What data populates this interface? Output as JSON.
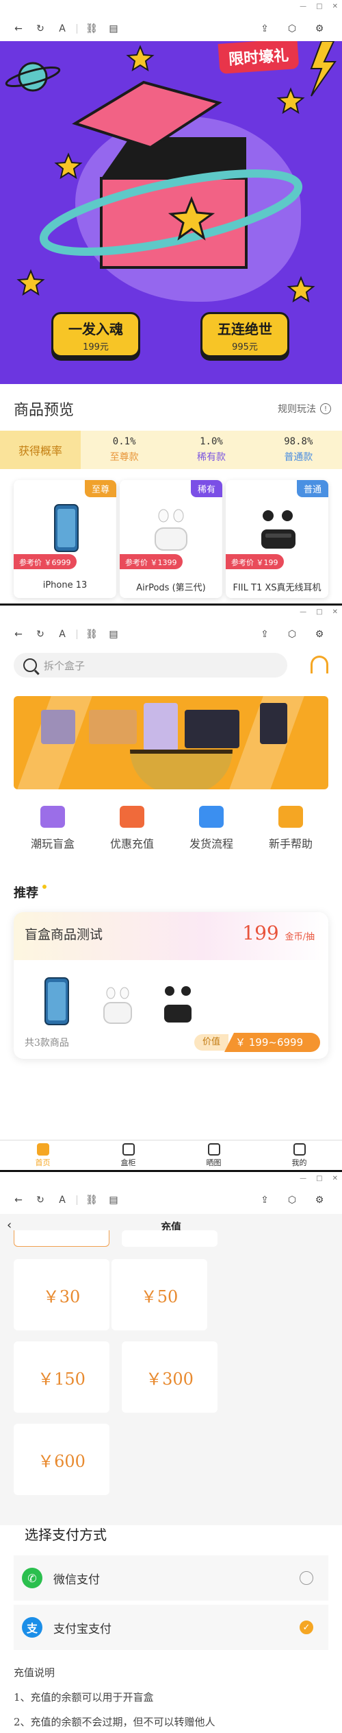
{
  "window": {
    "minimize": "—",
    "maximize": "□",
    "close": "✕"
  },
  "toolbar_icons": [
    "back-arrow-icon",
    "refresh-icon",
    "font-icon",
    "link-icon",
    "calendar-icon",
    "share-icon",
    "cube-icon",
    "settings-icon"
  ],
  "hero": {
    "promo": "限时壕礼",
    "single": {
      "label": "一发入魂",
      "price": "199元"
    },
    "five": {
      "label": "五连绝世",
      "price": "995元"
    }
  },
  "preview": {
    "title": "商品预览",
    "rules": "规则玩法",
    "prob_label": "获得概率",
    "tiers": [
      {
        "pct": "0.1%",
        "name": "至尊款",
        "color": "#e8963a"
      },
      {
        "pct": "1.0%",
        "name": "稀有款",
        "color": "#7b56e0"
      },
      {
        "pct": "98.8%",
        "name": "普通款",
        "color": "#4a8de0"
      }
    ],
    "products": [
      {
        "tag": "至尊",
        "tag_color": "#f0a12c",
        "ref": "参考价 ￥6999",
        "name": "iPhone 13"
      },
      {
        "tag": "稀有",
        "tag_color": "#7b4fe6",
        "ref": "参考价 ￥1399",
        "name": "AirPods (第三代)"
      },
      {
        "tag": "普通",
        "tag_color": "#4a90e2",
        "ref": "参考价 ￥199",
        "name": "FIIL T1 XS真无线耳机"
      }
    ]
  },
  "home": {
    "search_placeholder": "拆个盒子",
    "quick": [
      {
        "label": "潮玩盲盒",
        "color": "#9b6ee8"
      },
      {
        "label": "优惠充值",
        "color": "#f06a3a"
      },
      {
        "label": "发货流程",
        "color": "#3b8ff0"
      },
      {
        "label": "新手帮助",
        "color": "#f5a623"
      }
    ],
    "recommend": "推荐",
    "box": {
      "name": "盲盒商品测试",
      "price": "199",
      "unit": "金币/抽",
      "count": "共3款商品",
      "value_label": "价值",
      "value_range": "￥ 199~6999"
    },
    "tabs": [
      {
        "label": "首页",
        "active": true
      },
      {
        "label": "盒柜",
        "active": false
      },
      {
        "label": "晒图",
        "active": false
      },
      {
        "label": "我的",
        "active": false
      }
    ]
  },
  "recharge": {
    "title": "充值",
    "amounts": [
      "￥30",
      "￥50",
      "￥150",
      "￥300",
      "￥600"
    ],
    "pay_title": "选择支付方式",
    "methods": [
      {
        "label": "微信支付",
        "color": "#2bbf4e",
        "glyph": "✆",
        "selected": false
      },
      {
        "label": "支付宝支付",
        "color": "#1b8ee8",
        "glyph": "支",
        "selected": true
      }
    ],
    "notes_title": "充值说明",
    "notes": [
      "1、充值的余额可以用于开盲盒",
      "2、充值的余额不会过期，但不可以转赠他人"
    ]
  },
  "colors": {
    "hero_bg": "#6c36e0",
    "accent": "#f5a623",
    "price_red": "#e8533b"
  }
}
